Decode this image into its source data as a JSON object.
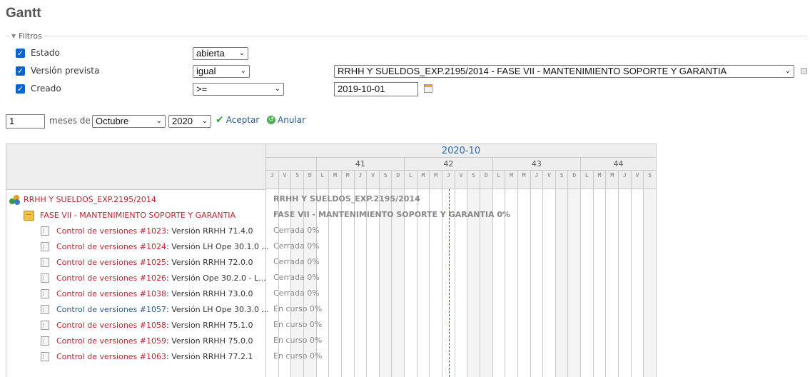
{
  "page": {
    "title": "Gantt"
  },
  "filters": {
    "legend": "Filtros",
    "rows": [
      {
        "label": "Estado",
        "operator": "abierta"
      },
      {
        "label": "Versión prevista",
        "operator": "igual",
        "value": "RRHH Y SUELDOS_EXP.2195/2014 - FASE VII - MANTENIMIENTO SOPORTE Y GARANTIA"
      },
      {
        "label": "Creado",
        "operator": ">=",
        "value": "2019-10-01"
      }
    ]
  },
  "controls": {
    "months_value": "1",
    "months_label": "meses de",
    "month_select": "Octubre",
    "year_select": "2020",
    "accept_label": "Aceptar",
    "cancel_label": "Anular"
  },
  "gantt": {
    "month_label": "2020-10",
    "weeks": [
      {
        "label": ""
      },
      {
        "label": "41"
      },
      {
        "label": "42"
      },
      {
        "label": "43"
      },
      {
        "label": "44"
      }
    ],
    "days": [
      "J",
      "V",
      "S",
      "D",
      "L",
      "M",
      "M",
      "J",
      "V",
      "S",
      "D",
      "L",
      "M",
      "M",
      "J",
      "V",
      "S",
      "D",
      "L",
      "M",
      "M",
      "J",
      "V",
      "S",
      "D",
      "L",
      "M",
      "M",
      "J",
      "V",
      "S"
    ],
    "project": {
      "name": "RRHH Y SUELDOS_EXP.2195/2014",
      "bar_label": "RRHH Y SUELDOS_EXP.2195/2014"
    },
    "version": {
      "name": "FASE VII - MANTENIMIENTO SOPORTE Y GARANTIA",
      "bar_label": "FASE VII - MANTENIMIENTO SOPORTE Y GARANTIA 0%"
    },
    "issues": [
      {
        "ref": "Control de versiones #1023",
        "subject": ": Versión RRHH 71.4.0",
        "status": "Cerrada 0%",
        "link_color": "red"
      },
      {
        "ref": "Control de versiones #1024",
        "subject": ": Versión LH Ope 30.1.0 ...",
        "status": "Cerrada 0%",
        "link_color": "red"
      },
      {
        "ref": "Control de versiones #1025",
        "subject": ": Versión RRHH 72.0.0",
        "status": "Cerrada 0%",
        "link_color": "red"
      },
      {
        "ref": "Control de versiones #1026",
        "subject": ": Versión Ope 30.2.0 - L...",
        "status": "Cerrada 0%",
        "link_color": "red"
      },
      {
        "ref": "Control de versiones #1038",
        "subject": ": Versión RRHH 73.0.0",
        "status": "Cerrada 0%",
        "link_color": "red"
      },
      {
        "ref": "Control de versiones #1057",
        "subject": ": Versión LH Ope 30.3.0 ...",
        "status": "En curso 0%",
        "link_color": "blue"
      },
      {
        "ref": "Control de versiones #1058",
        "subject": ": Version RRHH 75.1.0",
        "status": "En curso 0%",
        "link_color": "red"
      },
      {
        "ref": "Control de versiones #1059",
        "subject": ": Version RRHH 75.0.0",
        "status": "En curso 0%",
        "link_color": "red"
      },
      {
        "ref": "Control de versiones #1063",
        "subject": ": Versión RRHH 77.2.1",
        "status": "En curso 0%",
        "link_color": "red"
      }
    ]
  }
}
